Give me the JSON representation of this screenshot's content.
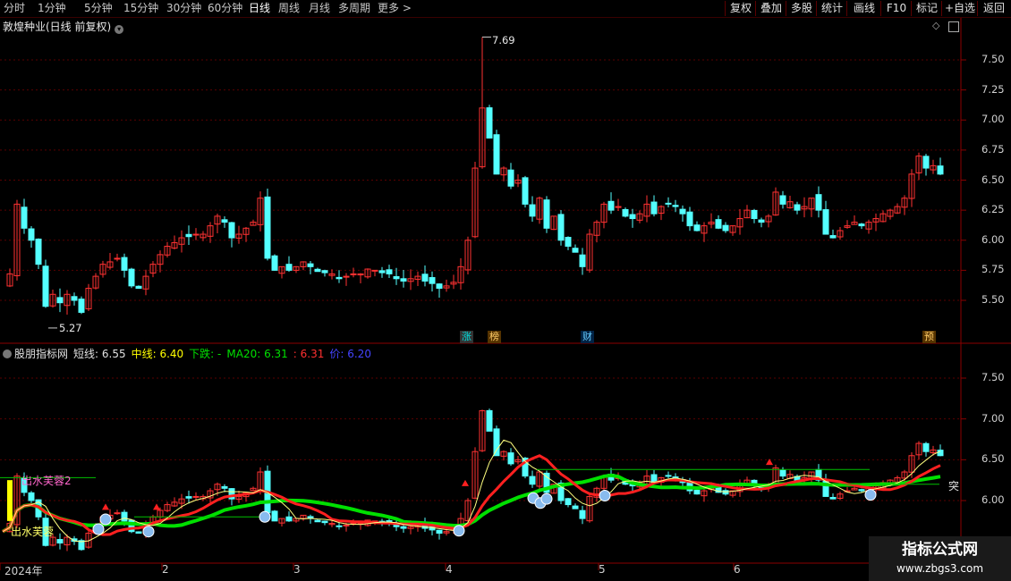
{
  "toolbar": {
    "periods": [
      "分时",
      "1分钟",
      "5分钟",
      "15分钟",
      "30分钟",
      "60分钟",
      "日线",
      "周线",
      "月线",
      "多周期",
      "更多 >"
    ],
    "active_period": "日线",
    "right_buttons": [
      "复权",
      "叠加",
      "多股",
      "统计",
      "画线",
      "F10",
      "标记",
      "+自选",
      "返回"
    ]
  },
  "main_chart": {
    "title": "敦煌种业(日线 前复权)",
    "high_label": "7.69",
    "low_label": "5.27",
    "y_ticks": [
      "7.50",
      "7.25",
      "7.00",
      "6.75",
      "6.50",
      "6.25",
      "6.00",
      "5.75",
      "5.50"
    ],
    "markers": [
      {
        "text": "涨",
        "color": "#00e0e0"
      },
      {
        "text": "榜",
        "color": "#ffcc66"
      },
      {
        "text": "财",
        "color": "#66ccff"
      },
      {
        "text": "预",
        "color": "#ffcc66"
      }
    ]
  },
  "indicator": {
    "name": "股朋指标网",
    "short_label": "短线: 6.55",
    "mid_label": "中线: 6.40",
    "down_label": "下跌: -",
    "ma20_label": "MA20: 6.31",
    "red_label": ": 6.31",
    "price_label": "价: 6.20",
    "colors": {
      "name": "#e0e0e0",
      "short": "#e0e0e0",
      "mid": "#ffff00",
      "down": "#00e000",
      "ma20": "#00e000",
      "red": "#ff3030",
      "price": "#4444ff"
    },
    "y_ticks": [
      "7.50",
      "7.00",
      "6.50",
      "6.00"
    ],
    "annot_top": "出水芙蓉2",
    "annot_bottom": "出水芙蓉",
    "annot_right": "突"
  },
  "dates": [
    "2024年",
    "2",
    "3",
    "4",
    "5",
    "6"
  ],
  "watermark": {
    "line1": "指标公式网",
    "line2": "www.zbgs3.com"
  }
}
